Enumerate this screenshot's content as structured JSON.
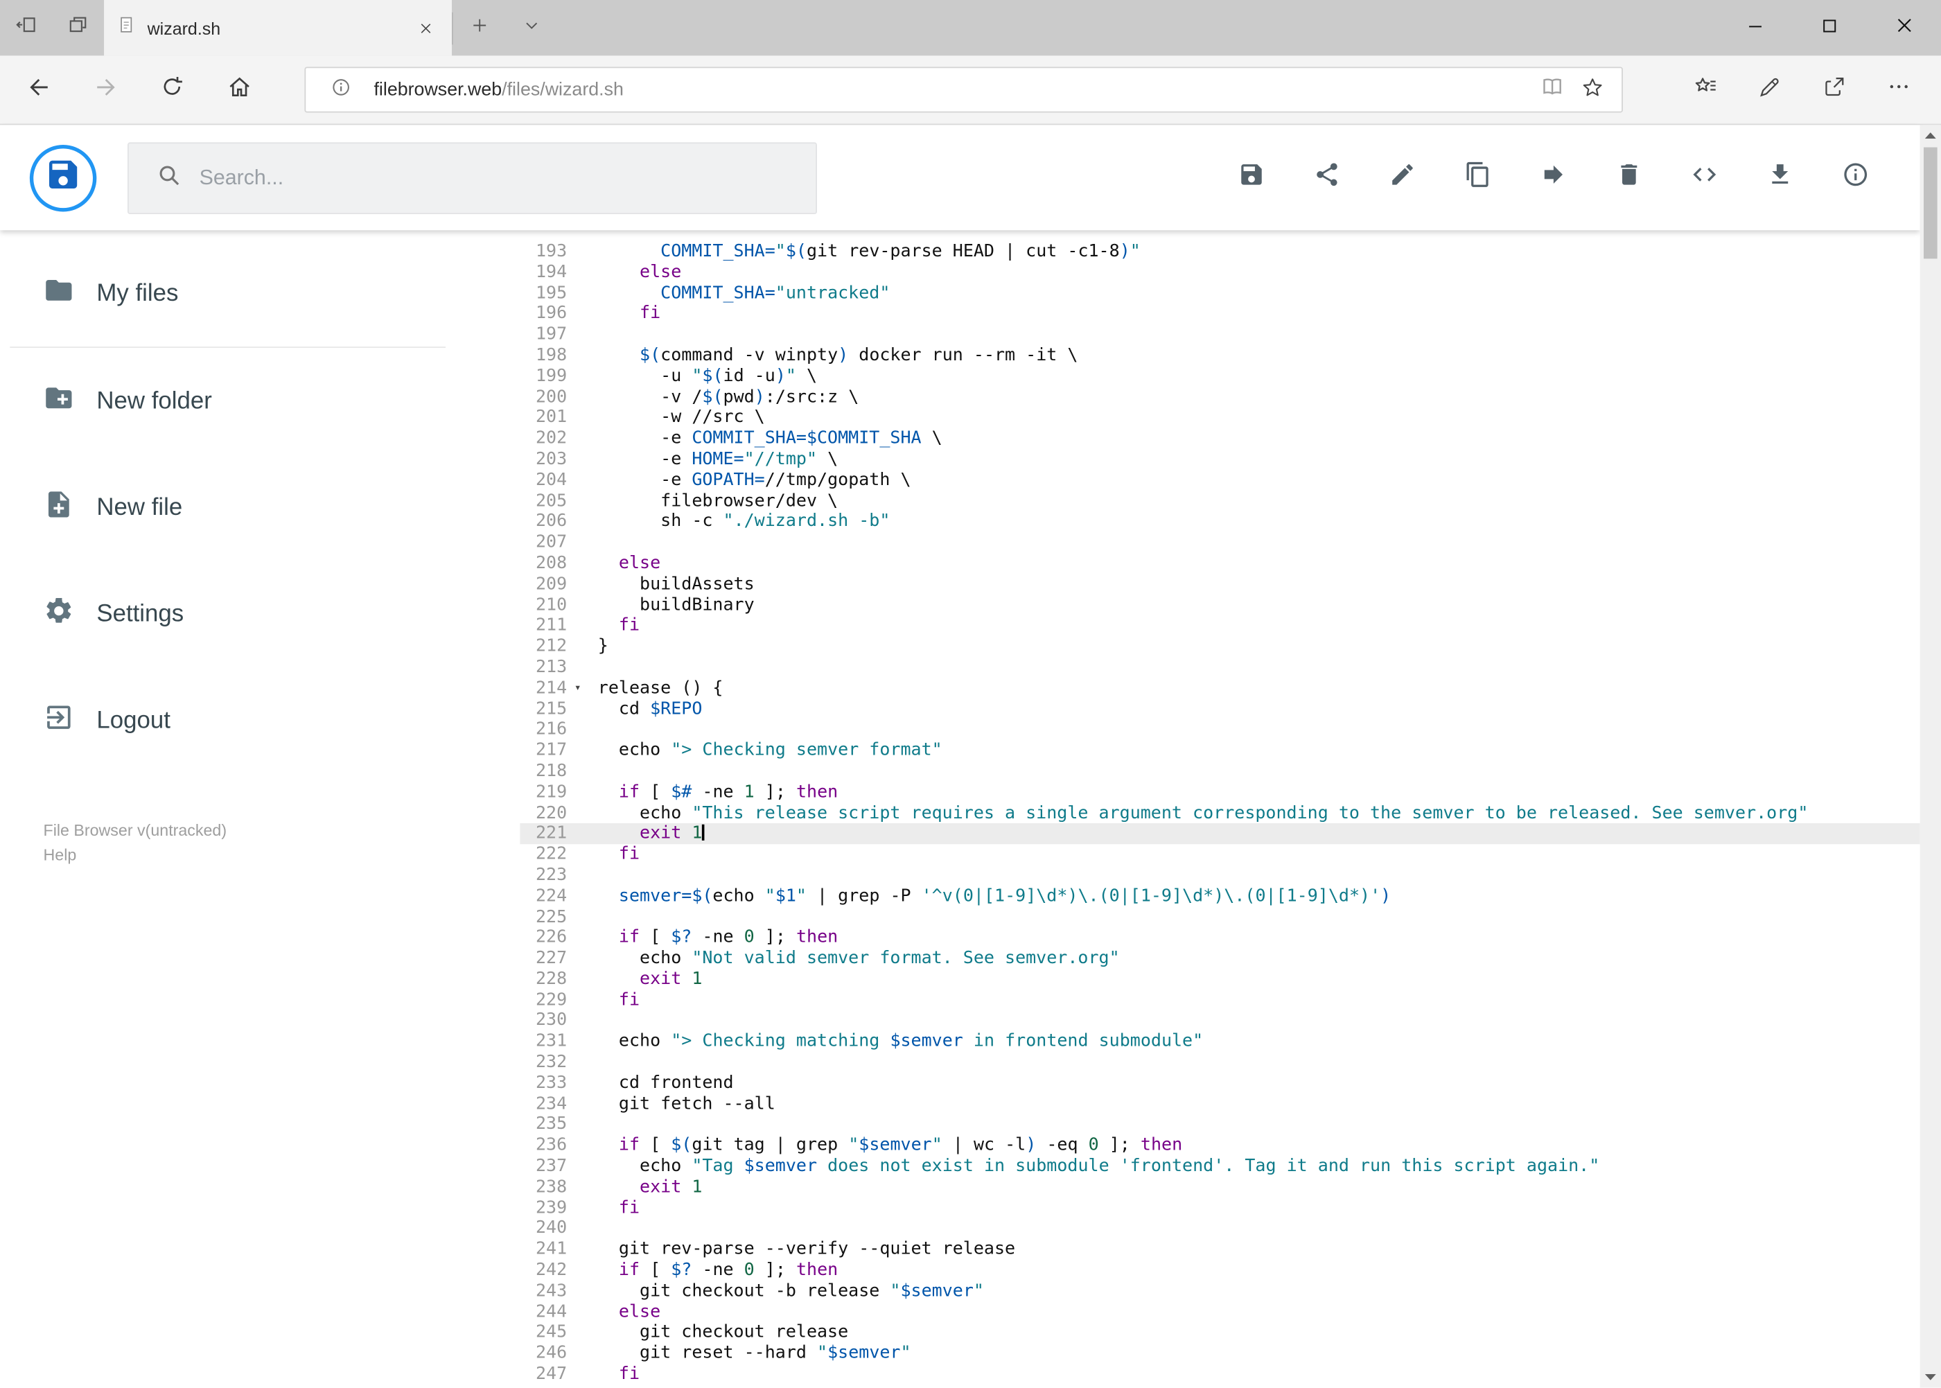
{
  "browser": {
    "tab_title": "wizard.sh",
    "url_host": "filebrowser.web",
    "url_path": "/files/wizard.sh",
    "left_tab_icons": [
      "set-tabs-aside-icon",
      "tab-previews-icon"
    ],
    "nav_icons": [
      "back-arrow-icon",
      "forward-arrow-icon",
      "refresh-icon",
      "home-icon"
    ],
    "address_icons": [
      "site-info-icon",
      "reading-view-icon",
      "favorite-star-icon"
    ],
    "right_icons": [
      "hub-icon",
      "web-note-pen-icon",
      "share-icon",
      "more-dots-icon"
    ],
    "window_controls": [
      "minimize-icon",
      "maximize-icon",
      "close-icon"
    ]
  },
  "header": {
    "search_placeholder": "Search...",
    "toolbar_icons": [
      "save-icon",
      "share-icon",
      "rename-pencil-icon",
      "copy-icon",
      "move-arrow-icon",
      "delete-trash-icon",
      "source-code-icon",
      "download-icon",
      "info-icon"
    ],
    "logo_icon": "floppy-disk-icon"
  },
  "sidebar": {
    "items": [
      {
        "icon": "folder-icon",
        "label": "My files"
      },
      {
        "icon": "new-folder-icon",
        "label": "New folder"
      },
      {
        "icon": "new-file-icon",
        "label": "New file"
      },
      {
        "icon": "settings-gear-icon",
        "label": "Settings"
      },
      {
        "icon": "logout-icon",
        "label": "Logout"
      }
    ],
    "version": "File Browser v(untracked)",
    "help": "Help"
  },
  "colors": {
    "accent_blue": "#2196f3",
    "keyword": "#770088",
    "variable": "#0055aa",
    "string": "#0f7b8a",
    "number": "#116644",
    "active_line_bg": "#ececec"
  },
  "editor": {
    "active_line": 221,
    "folded_marker_line": 214,
    "lines": [
      {
        "n": 193,
        "seg": [
          [
            "p",
            "      "
          ],
          [
            "v",
            "COMMIT_SHA="
          ],
          [
            "s",
            "\""
          ],
          [
            "v",
            "$("
          ],
          [
            "p",
            "git rev-parse HEAD | cut -c1-8"
          ],
          [
            "v",
            ")"
          ],
          [
            "s",
            "\""
          ]
        ]
      },
      {
        "n": 194,
        "seg": [
          [
            "p",
            "    "
          ],
          [
            "k",
            "else"
          ]
        ]
      },
      {
        "n": 195,
        "seg": [
          [
            "p",
            "      "
          ],
          [
            "v",
            "COMMIT_SHA="
          ],
          [
            "s",
            "\"untracked\""
          ]
        ]
      },
      {
        "n": 196,
        "seg": [
          [
            "p",
            "    "
          ],
          [
            "k",
            "fi"
          ]
        ]
      },
      {
        "n": 197,
        "seg": []
      },
      {
        "n": 198,
        "seg": [
          [
            "p",
            "    "
          ],
          [
            "v",
            "$("
          ],
          [
            "p",
            "command -v winpty"
          ],
          [
            "v",
            ")"
          ],
          [
            "p",
            " docker run --rm -it \\"
          ]
        ]
      },
      {
        "n": 199,
        "seg": [
          [
            "p",
            "      -u "
          ],
          [
            "s",
            "\""
          ],
          [
            "v",
            "$("
          ],
          [
            "p",
            "id -u"
          ],
          [
            "v",
            ")"
          ],
          [
            "s",
            "\""
          ],
          [
            "p",
            " \\"
          ]
        ]
      },
      {
        "n": 200,
        "seg": [
          [
            "p",
            "      -v /"
          ],
          [
            "v",
            "$("
          ],
          [
            "p",
            "pwd"
          ],
          [
            "v",
            ")"
          ],
          [
            "p",
            ":/src:z \\"
          ]
        ]
      },
      {
        "n": 201,
        "seg": [
          [
            "p",
            "      -w //src \\"
          ]
        ]
      },
      {
        "n": 202,
        "seg": [
          [
            "p",
            "      -e "
          ],
          [
            "v",
            "COMMIT_SHA=$COMMIT_SHA"
          ],
          [
            "p",
            " \\"
          ]
        ]
      },
      {
        "n": 203,
        "seg": [
          [
            "p",
            "      -e "
          ],
          [
            "v",
            "HOME="
          ],
          [
            "s",
            "\"//tmp\""
          ],
          [
            "p",
            " \\"
          ]
        ]
      },
      {
        "n": 204,
        "seg": [
          [
            "p",
            "      -e "
          ],
          [
            "v",
            "GOPATH="
          ],
          [
            "p",
            "//tmp/gopath \\"
          ]
        ]
      },
      {
        "n": 205,
        "seg": [
          [
            "p",
            "      filebrowser/dev \\"
          ]
        ]
      },
      {
        "n": 206,
        "seg": [
          [
            "p",
            "      sh -c "
          ],
          [
            "s",
            "\"./wizard.sh -b\""
          ]
        ]
      },
      {
        "n": 207,
        "seg": []
      },
      {
        "n": 208,
        "seg": [
          [
            "p",
            "  "
          ],
          [
            "k",
            "else"
          ]
        ]
      },
      {
        "n": 209,
        "seg": [
          [
            "p",
            "    buildAssets"
          ]
        ]
      },
      {
        "n": 210,
        "seg": [
          [
            "p",
            "    buildBinary"
          ]
        ]
      },
      {
        "n": 211,
        "seg": [
          [
            "p",
            "  "
          ],
          [
            "k",
            "fi"
          ]
        ]
      },
      {
        "n": 212,
        "seg": [
          [
            "p",
            "}"
          ]
        ]
      },
      {
        "n": 213,
        "seg": []
      },
      {
        "n": 214,
        "seg": [
          [
            "p",
            "release () {"
          ]
        ]
      },
      {
        "n": 215,
        "seg": [
          [
            "p",
            "  cd "
          ],
          [
            "v",
            "$REPO"
          ]
        ]
      },
      {
        "n": 216,
        "seg": []
      },
      {
        "n": 217,
        "seg": [
          [
            "p",
            "  echo "
          ],
          [
            "s",
            "\"> Checking semver format\""
          ]
        ]
      },
      {
        "n": 218,
        "seg": []
      },
      {
        "n": 219,
        "seg": [
          [
            "p",
            "  "
          ],
          [
            "k",
            "if"
          ],
          [
            "p",
            " [ "
          ],
          [
            "v",
            "$#"
          ],
          [
            "p",
            " -ne "
          ],
          [
            "n",
            "1"
          ],
          [
            "p",
            " ]; "
          ],
          [
            "k",
            "then"
          ]
        ]
      },
      {
        "n": 220,
        "seg": [
          [
            "p",
            "    echo "
          ],
          [
            "s",
            "\"This release script requires a single argument corresponding to the semver to be released. See semver.org\""
          ]
        ]
      },
      {
        "n": 221,
        "seg": [
          [
            "p",
            "    "
          ],
          [
            "k",
            "exit"
          ],
          [
            "p",
            " "
          ],
          [
            "n",
            "1"
          ]
        ]
      },
      {
        "n": 222,
        "seg": [
          [
            "p",
            "  "
          ],
          [
            "k",
            "fi"
          ]
        ]
      },
      {
        "n": 223,
        "seg": []
      },
      {
        "n": 224,
        "seg": [
          [
            "p",
            "  "
          ],
          [
            "v",
            "semver=$("
          ],
          [
            "p",
            "echo "
          ],
          [
            "s",
            "\""
          ],
          [
            "v",
            "$1"
          ],
          [
            "s",
            "\""
          ],
          [
            "p",
            " | grep -P "
          ],
          [
            "s",
            "'^v(0|[1-9]\\d*)\\.(0|[1-9]\\d*)\\.(0|[1-9]\\d*)'"
          ],
          [
            "v",
            ")"
          ]
        ]
      },
      {
        "n": 225,
        "seg": []
      },
      {
        "n": 226,
        "seg": [
          [
            "p",
            "  "
          ],
          [
            "k",
            "if"
          ],
          [
            "p",
            " [ "
          ],
          [
            "v",
            "$?"
          ],
          [
            "p",
            " -ne "
          ],
          [
            "n",
            "0"
          ],
          [
            "p",
            " ]; "
          ],
          [
            "k",
            "then"
          ]
        ]
      },
      {
        "n": 227,
        "seg": [
          [
            "p",
            "    echo "
          ],
          [
            "s",
            "\"Not valid semver format. See semver.org\""
          ]
        ]
      },
      {
        "n": 228,
        "seg": [
          [
            "p",
            "    "
          ],
          [
            "k",
            "exit"
          ],
          [
            "p",
            " "
          ],
          [
            "n",
            "1"
          ]
        ]
      },
      {
        "n": 229,
        "seg": [
          [
            "p",
            "  "
          ],
          [
            "k",
            "fi"
          ]
        ]
      },
      {
        "n": 230,
        "seg": []
      },
      {
        "n": 231,
        "seg": [
          [
            "p",
            "  echo "
          ],
          [
            "s",
            "\"> Checking matching "
          ],
          [
            "v",
            "$semver"
          ],
          [
            "s",
            " in frontend submodule\""
          ]
        ]
      },
      {
        "n": 232,
        "seg": []
      },
      {
        "n": 233,
        "seg": [
          [
            "p",
            "  cd frontend"
          ]
        ]
      },
      {
        "n": 234,
        "seg": [
          [
            "p",
            "  git fetch --all"
          ]
        ]
      },
      {
        "n": 235,
        "seg": []
      },
      {
        "n": 236,
        "seg": [
          [
            "p",
            "  "
          ],
          [
            "k",
            "if"
          ],
          [
            "p",
            " [ "
          ],
          [
            "v",
            "$("
          ],
          [
            "p",
            "git tag | grep "
          ],
          [
            "s",
            "\""
          ],
          [
            "v",
            "$semver"
          ],
          [
            "s",
            "\""
          ],
          [
            "p",
            " | wc -l"
          ],
          [
            "v",
            ")"
          ],
          [
            "p",
            " -eq "
          ],
          [
            "n",
            "0"
          ],
          [
            "p",
            " ]; "
          ],
          [
            "k",
            "then"
          ]
        ]
      },
      {
        "n": 237,
        "seg": [
          [
            "p",
            "    echo "
          ],
          [
            "s",
            "\"Tag "
          ],
          [
            "v",
            "$semver"
          ],
          [
            "s",
            " does not exist in submodule 'frontend'. Tag it and run this script again.\""
          ]
        ]
      },
      {
        "n": 238,
        "seg": [
          [
            "p",
            "    "
          ],
          [
            "k",
            "exit"
          ],
          [
            "p",
            " "
          ],
          [
            "n",
            "1"
          ]
        ]
      },
      {
        "n": 239,
        "seg": [
          [
            "p",
            "  "
          ],
          [
            "k",
            "fi"
          ]
        ]
      },
      {
        "n": 240,
        "seg": []
      },
      {
        "n": 241,
        "seg": [
          [
            "p",
            "  git rev-parse --verify --quiet release"
          ]
        ]
      },
      {
        "n": 242,
        "seg": [
          [
            "p",
            "  "
          ],
          [
            "k",
            "if"
          ],
          [
            "p",
            " [ "
          ],
          [
            "v",
            "$?"
          ],
          [
            "p",
            " -ne "
          ],
          [
            "n",
            "0"
          ],
          [
            "p",
            " ]; "
          ],
          [
            "k",
            "then"
          ]
        ]
      },
      {
        "n": 243,
        "seg": [
          [
            "p",
            "    git checkout -b release "
          ],
          [
            "s",
            "\""
          ],
          [
            "v",
            "$semver"
          ],
          [
            "s",
            "\""
          ]
        ]
      },
      {
        "n": 244,
        "seg": [
          [
            "p",
            "  "
          ],
          [
            "k",
            "else"
          ]
        ]
      },
      {
        "n": 245,
        "seg": [
          [
            "p",
            "    git checkout release"
          ]
        ]
      },
      {
        "n": 246,
        "seg": [
          [
            "p",
            "    git reset --hard "
          ],
          [
            "s",
            "\""
          ],
          [
            "v",
            "$semver"
          ],
          [
            "s",
            "\""
          ]
        ]
      },
      {
        "n": 247,
        "seg": [
          [
            "p",
            "  "
          ],
          [
            "k",
            "fi"
          ]
        ]
      }
    ]
  }
}
